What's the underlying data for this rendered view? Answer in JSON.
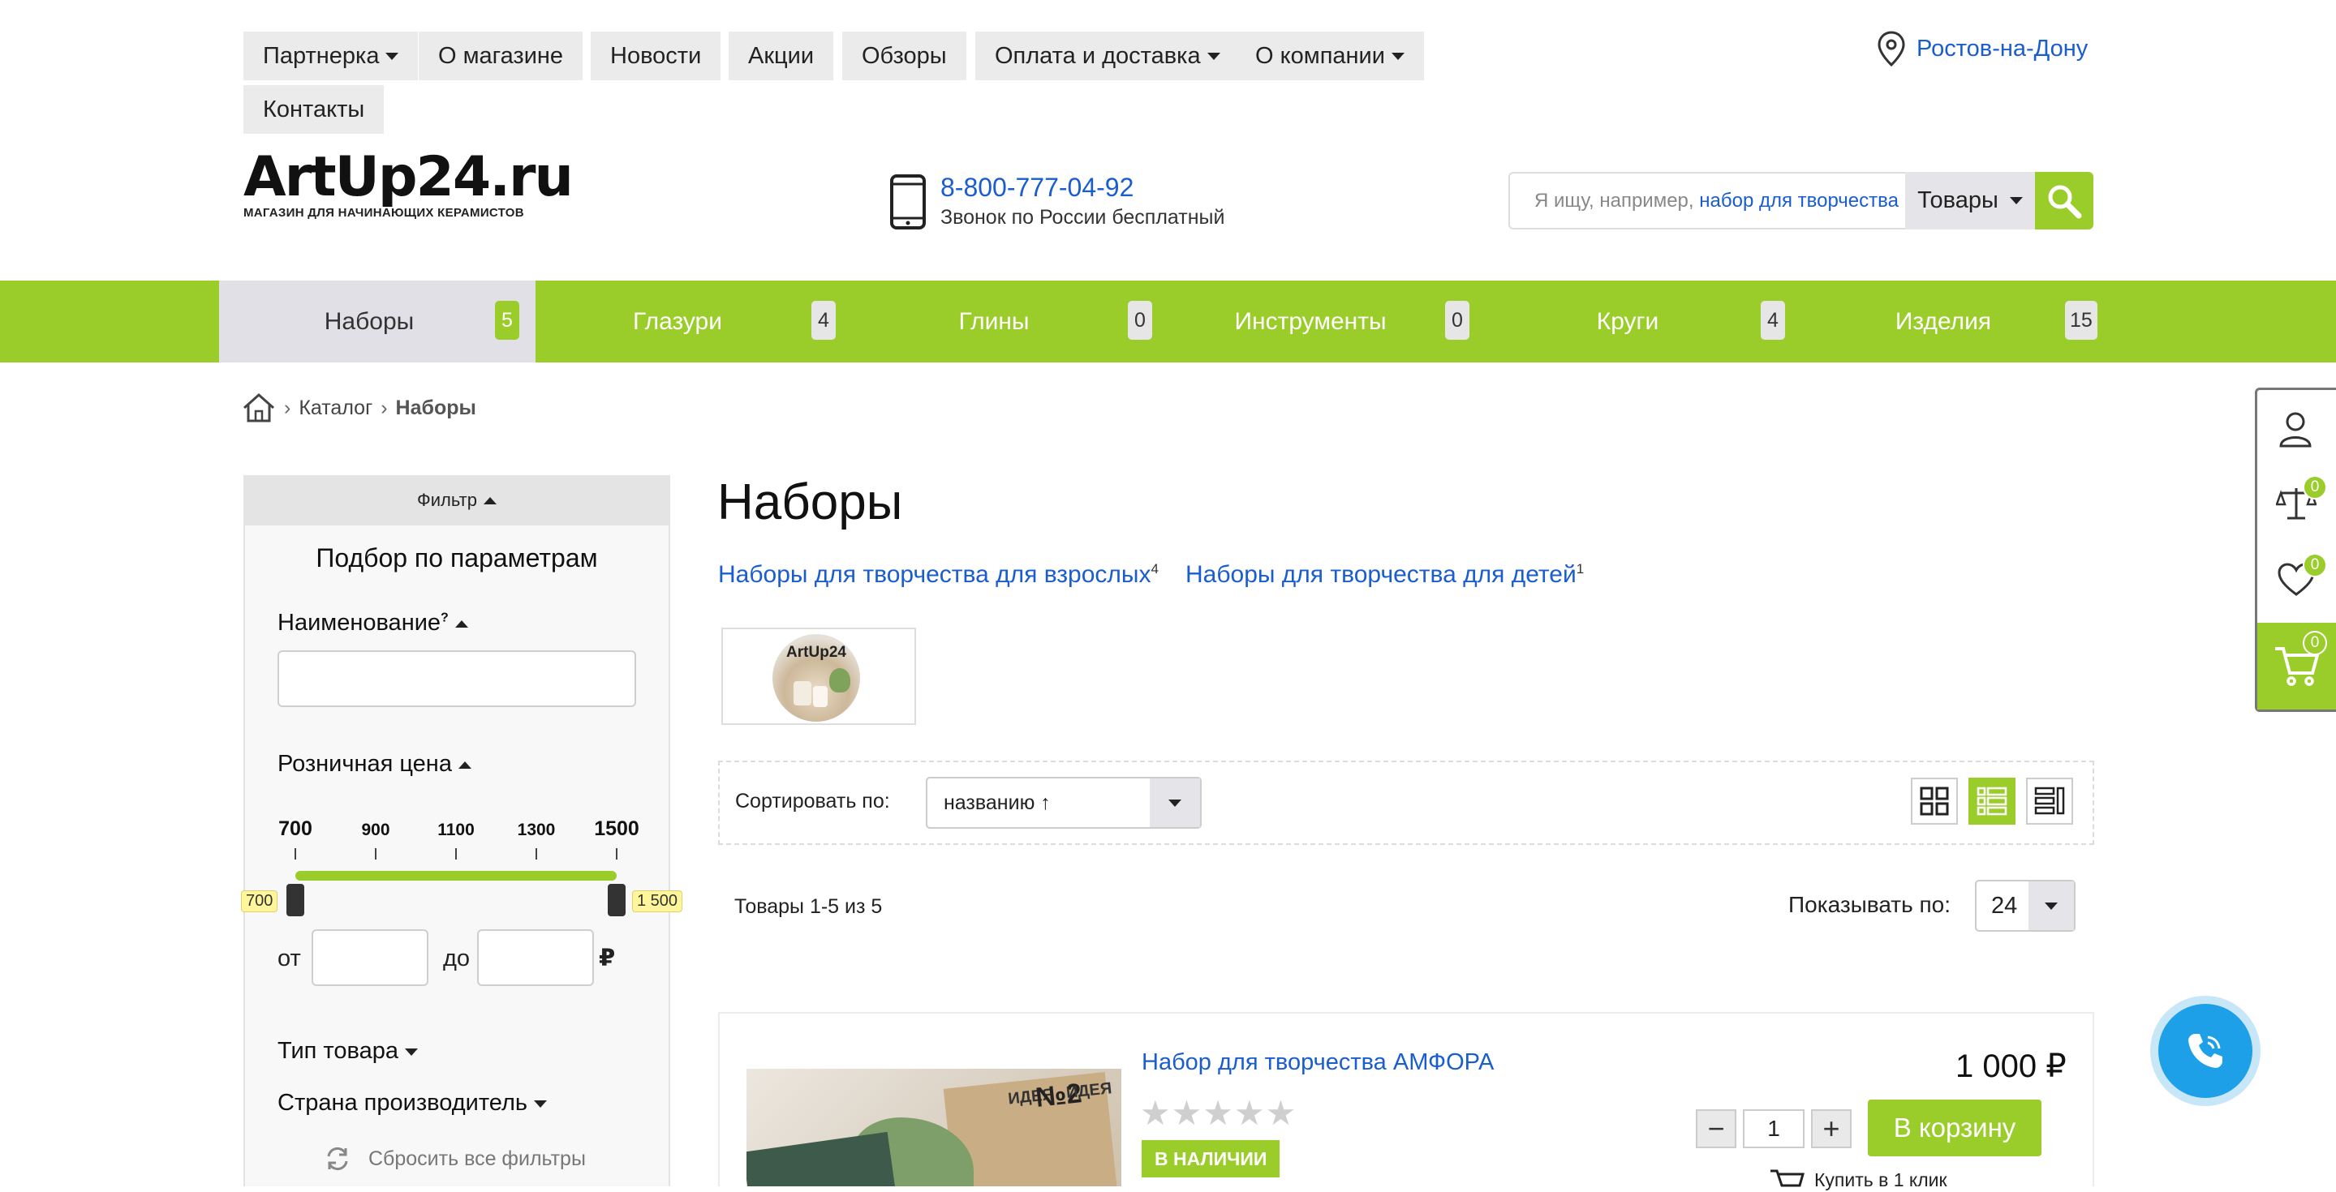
{
  "topmenu": {
    "items": [
      {
        "label": "Партнерка",
        "dropdown": true
      },
      {
        "label": "О магазине",
        "dropdown": false
      },
      {
        "label": "Новости",
        "dropdown": false
      },
      {
        "label": "Акции",
        "dropdown": false
      },
      {
        "label": "Обзоры",
        "dropdown": false
      },
      {
        "label": "Оплата и доставка",
        "dropdown": true
      },
      {
        "label": "О компании",
        "dropdown": true
      },
      {
        "label": "Контакты",
        "dropdown": false
      }
    ],
    "city": "Ростов-на-Дону"
  },
  "logo": {
    "title": "ArtUp24.ru",
    "subtitle": "МАГАЗИН ДЛЯ НАЧИНАЮЩИХ КЕРАМИСТОВ"
  },
  "contact": {
    "phone": "8-800-777-04-92",
    "note": "Звонок по России бесплатный"
  },
  "search": {
    "placeholder": "Я ищу, например,",
    "example": "набор для творчества",
    "scope": "Товары"
  },
  "nav": {
    "items": [
      {
        "label": "Наборы",
        "count": "5",
        "active": true
      },
      {
        "label": "Глазури",
        "count": "4",
        "active": false
      },
      {
        "label": "Глины",
        "count": "0",
        "active": false
      },
      {
        "label": "Инструменты",
        "count": "0",
        "active": false
      },
      {
        "label": "Круги",
        "count": "4",
        "active": false
      },
      {
        "label": "Изделия",
        "count": "15",
        "active": false
      }
    ]
  },
  "breadcrumb": {
    "catalog": "Каталог",
    "current": "Наборы",
    "sep": "›"
  },
  "filter": {
    "toggle": "Фильтр",
    "title": "Подбор по параметрам",
    "name_label": "Наименование",
    "name_hint": "?",
    "price_label": "Розничная цена",
    "price_ticks": [
      "700",
      "900",
      "1100",
      "1300",
      "1500"
    ],
    "price_min_tag": "700",
    "price_max_tag": "1 500",
    "from": "от",
    "to": "до",
    "currency": "₽",
    "type_label": "Тип товара",
    "country_label": "Страна производитель",
    "reset": "Сбросить все фильтры"
  },
  "page": {
    "title": "Наборы",
    "subcats": [
      {
        "label": "Наборы для творчества для взрослых",
        "count": "4"
      },
      {
        "label": "Наборы для творчества для детей",
        "count": "1"
      }
    ],
    "thumb_text": "ArtUp24"
  },
  "sort": {
    "label": "Сортировать по:",
    "value": "названию ↑"
  },
  "list": {
    "summary": "Товары 1-5 из 5",
    "per_page_label": "Показывать по:",
    "per_page": "24"
  },
  "product": {
    "name": "Набор для творчества АМФОРА",
    "price": "1 000 ₽",
    "stock": "В НАЛИЧИИ",
    "qty": "1",
    "minus": "−",
    "plus": "+",
    "cart": "В корзину",
    "one_click": "Купить в 1 клик",
    "image_text_1": "ИДЕЯ",
    "image_text_2": "№2",
    "image_text_3": "ИДЕЯ"
  },
  "side_counts": {
    "compare": "0",
    "favorites": "0",
    "cart": "0"
  },
  "colors": {
    "accent": "#9acd2a",
    "link": "#1a5dcf",
    "callbtn": "#1ea0e8"
  }
}
